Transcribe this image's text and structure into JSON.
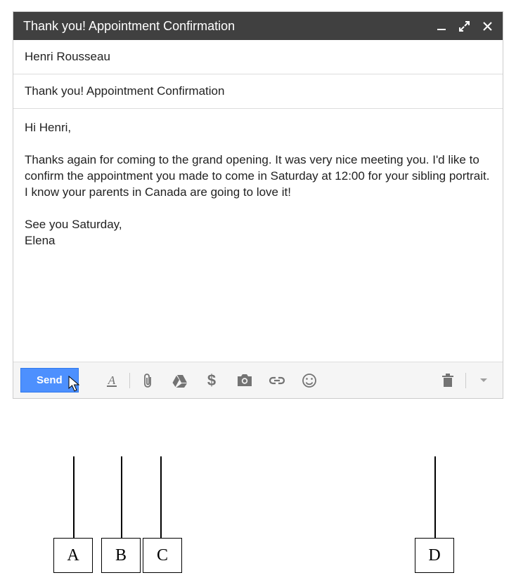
{
  "window": {
    "title": "Thank you! Appointment Confirmation"
  },
  "fields": {
    "to": "Henri Rousseau",
    "subject": "Thank you! Appointment Confirmation"
  },
  "body": "Hi Henri,\n\nThanks again for coming to the grand opening. It was very nice meeting you. I'd like to confirm the appointment you made to come in Saturday at 12:00 for your sibling portrait. I know your parents in Canada are going to love it!\n\nSee you Saturday,\nElena",
  "toolbar": {
    "send_label": "Send"
  },
  "annotations": {
    "a": "A",
    "b": "B",
    "c": "C",
    "d": "D"
  }
}
